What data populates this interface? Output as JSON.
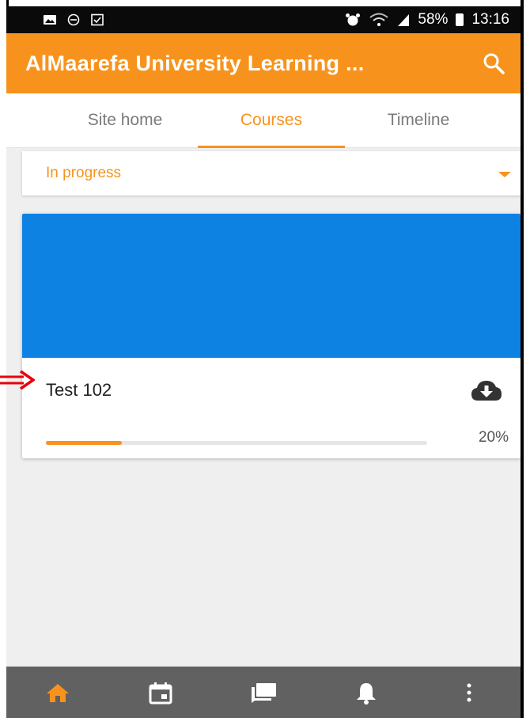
{
  "status_bar": {
    "battery": "58%",
    "time": "13:16"
  },
  "app_bar": {
    "title": "AlMaarefa University Learning ..."
  },
  "tabs": [
    {
      "label": "Site home",
      "active": false
    },
    {
      "label": "Courses",
      "active": true
    },
    {
      "label": "Timeline",
      "active": false
    }
  ],
  "filter": {
    "selected": "In progress"
  },
  "course": {
    "name": "Test 102",
    "progress": 20,
    "progress_label": "20%"
  },
  "colors": {
    "accent": "#f7931d",
    "course_image": "#0e82e2",
    "nav_bg": "#616161"
  },
  "icons": {
    "status_left": [
      "image-icon",
      "do-not-disturb-icon",
      "checkbox-icon"
    ],
    "status_right": [
      "alarm-icon",
      "wifi-icon",
      "signal-icon",
      "battery-icon"
    ],
    "bottom_nav": [
      "home-icon",
      "calendar-icon",
      "messages-icon",
      "notifications-icon",
      "more-icon"
    ]
  }
}
